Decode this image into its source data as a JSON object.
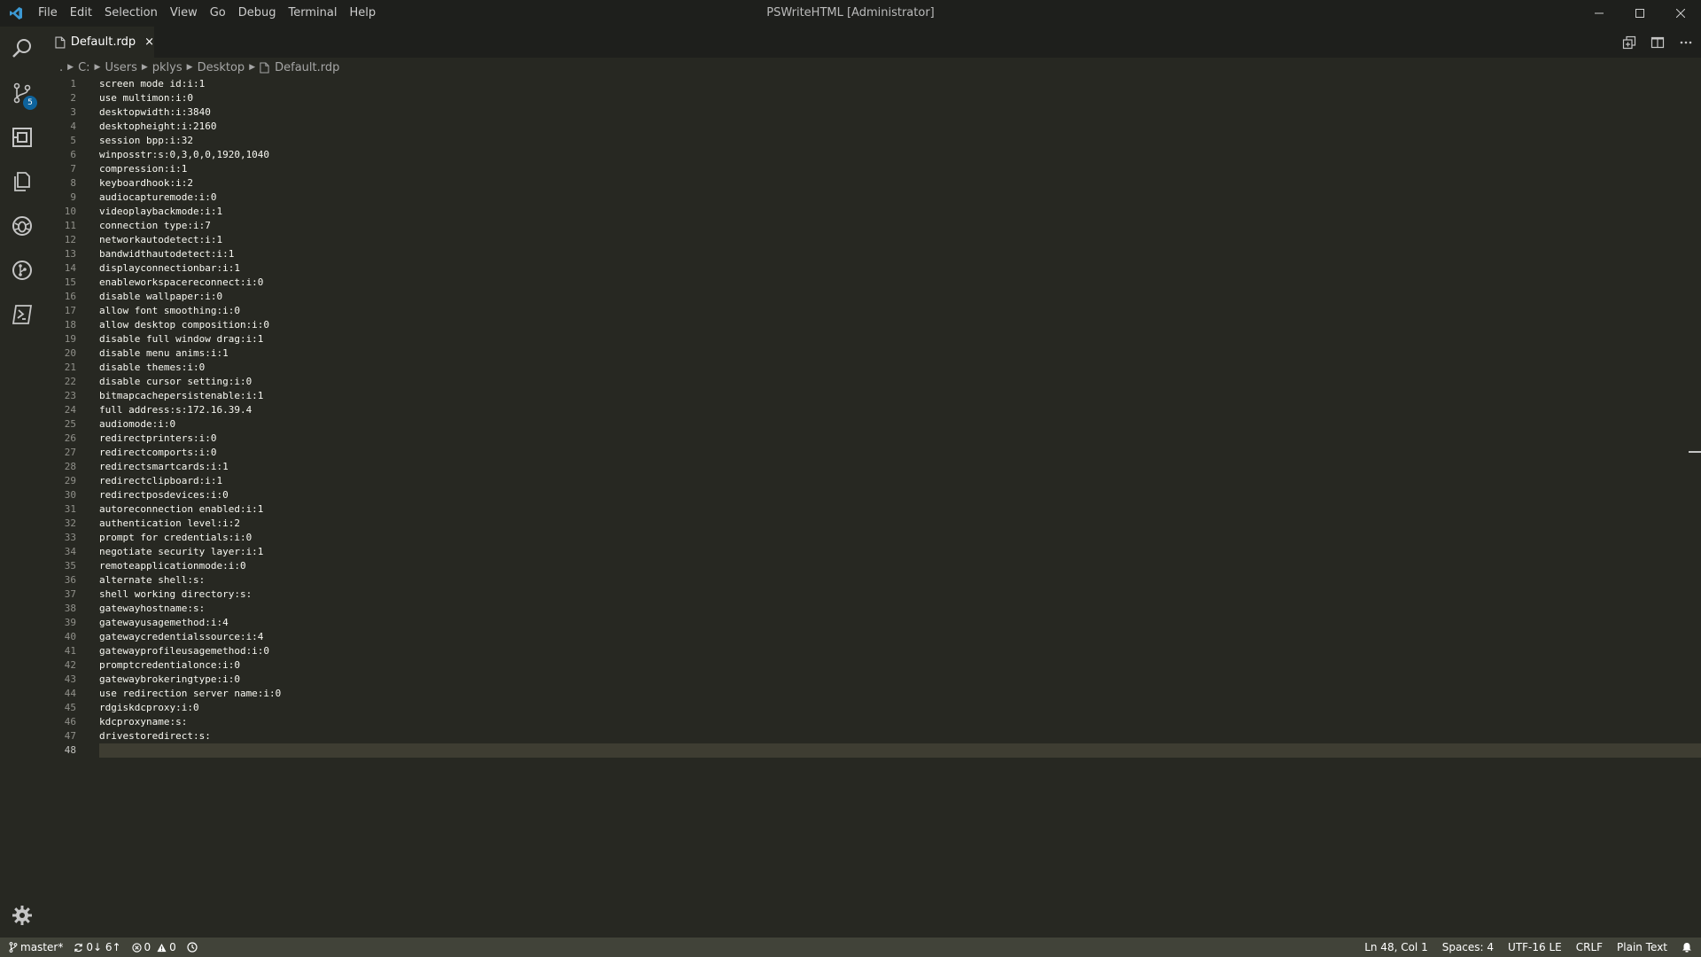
{
  "menu": [
    "File",
    "Edit",
    "Selection",
    "View",
    "Go",
    "Debug",
    "Terminal",
    "Help"
  ],
  "window_title": "PSWriteHTML [Administrator]",
  "activity": {
    "source_control_badge": "5"
  },
  "tab": {
    "label": "Default.rdp",
    "close": "×"
  },
  "breadcrumb": [
    "C:",
    "Users",
    "pklys",
    "Desktop",
    "Default.rdp"
  ],
  "breadcrumb_prefix": ".",
  "editor": {
    "lines": [
      "screen mode id:i:1",
      "use multimon:i:0",
      "desktopwidth:i:3840",
      "desktopheight:i:2160",
      "session bpp:i:32",
      "winposstr:s:0,3,0,0,1920,1040",
      "compression:i:1",
      "keyboardhook:i:2",
      "audiocapturemode:i:0",
      "videoplaybackmode:i:1",
      "connection type:i:7",
      "networkautodetect:i:1",
      "bandwidthautodetect:i:1",
      "displayconnectionbar:i:1",
      "enableworkspacereconnect:i:0",
      "disable wallpaper:i:0",
      "allow font smoothing:i:0",
      "allow desktop composition:i:0",
      "disable full window drag:i:1",
      "disable menu anims:i:1",
      "disable themes:i:0",
      "disable cursor setting:i:0",
      "bitmapcachepersistenable:i:1",
      "full address:s:172.16.39.4",
      "audiomode:i:0",
      "redirectprinters:i:0",
      "redirectcomports:i:0",
      "redirectsmartcards:i:1",
      "redirectclipboard:i:1",
      "redirectposdevices:i:0",
      "autoreconnection enabled:i:1",
      "authentication level:i:2",
      "prompt for credentials:i:0",
      "negotiate security layer:i:1",
      "remoteapplicationmode:i:0",
      "alternate shell:s:",
      "shell working directory:s:",
      "gatewayhostname:s:",
      "gatewayusagemethod:i:4",
      "gatewaycredentialssource:i:4",
      "gatewayprofileusagemethod:i:0",
      "promptcredentialonce:i:0",
      "gatewaybrokeringtype:i:0",
      "use redirection server name:i:0",
      "rdgiskdcproxy:i:0",
      "kdcproxyname:s:",
      "drivestoredirect:s:",
      ""
    ],
    "current_line": 48
  },
  "status": {
    "branch": "master*",
    "sync": "0↓ 6↑",
    "errors": "0",
    "warnings": "0",
    "cursor": "Ln 48, Col 1",
    "spaces": "Spaces: 4",
    "encoding": "UTF-16 LE",
    "eol": "CRLF",
    "language": "Plain Text"
  }
}
